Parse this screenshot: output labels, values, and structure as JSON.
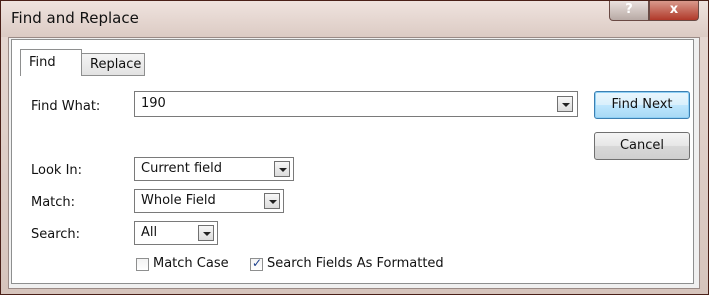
{
  "window": {
    "title": "Find and Replace",
    "help_label": "?",
    "close_label": "x"
  },
  "tabs": [
    {
      "label": "Find",
      "selected": true
    },
    {
      "label": "Replace",
      "selected": false
    }
  ],
  "find_what": {
    "label": "Find What:",
    "value": "190"
  },
  "look_in": {
    "label": "Look In:",
    "value": "Current field"
  },
  "match": {
    "label": "Match:",
    "value": "Whole Field"
  },
  "search": {
    "label": "Search:",
    "value": "All"
  },
  "buttons": {
    "find_next": "Find Next",
    "cancel": "Cancel"
  },
  "checkboxes": {
    "match_case": {
      "label": "Match Case",
      "checked": false
    },
    "search_formatted": {
      "label": "Search Fields As Formatted",
      "checked": true,
      "mark": "✓"
    }
  },
  "colors": {
    "accent": "#3c7fb1",
    "title_bg": "#dccbc4",
    "close_button": "#b0392a"
  }
}
